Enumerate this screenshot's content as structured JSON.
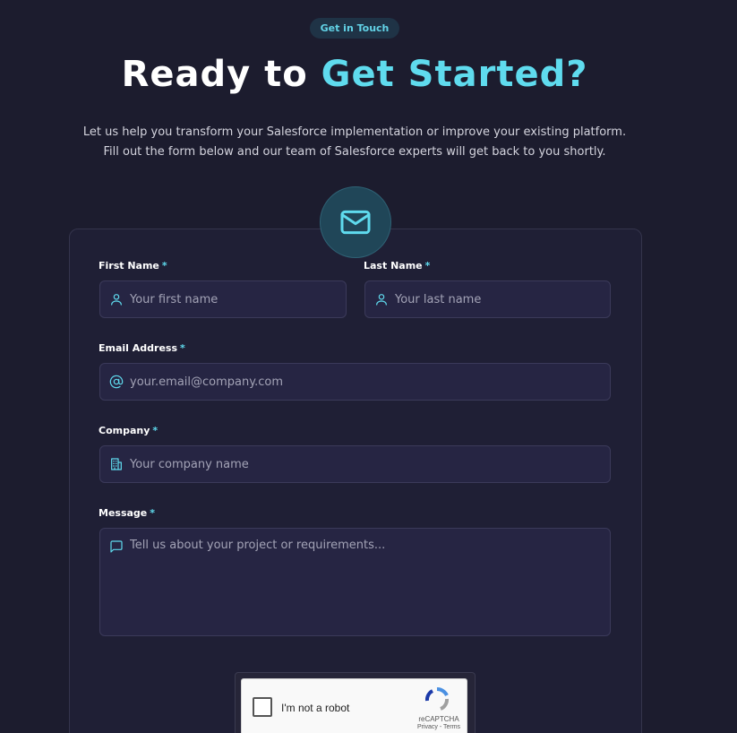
{
  "badge": "Get in Touch",
  "hero": {
    "title_main": "Ready to ",
    "title_accent": "Get Started?",
    "intro": "Let us help you transform your Salesforce implementation or improve your existing platform. Fill out the form below and our team of Salesforce experts will get back to you shortly."
  },
  "form": {
    "required_marker": "*",
    "first_name": {
      "label": "First Name",
      "placeholder": "Your first name",
      "value": ""
    },
    "last_name": {
      "label": "Last Name",
      "placeholder": "Your last name",
      "value": ""
    },
    "email": {
      "label": "Email Address",
      "placeholder": "your.email@company.com",
      "value": ""
    },
    "company": {
      "label": "Company",
      "placeholder": "Your company name",
      "value": ""
    },
    "message": {
      "label": "Message",
      "placeholder": "Tell us about your project or requirements...",
      "value": ""
    }
  },
  "captcha": {
    "label": "I'm not a robot",
    "brand": "reCAPTCHA",
    "links": "Privacy - Terms"
  },
  "icons": {
    "header": "mail-icon",
    "first_name": "user-icon",
    "last_name": "user-icon",
    "email": "at-icon",
    "company": "building-icon",
    "message": "chat-icon"
  },
  "colors": {
    "background": "#1c1c2e",
    "accent": "#5fdbee",
    "card": "#1f1f35",
    "input": "#262543"
  }
}
